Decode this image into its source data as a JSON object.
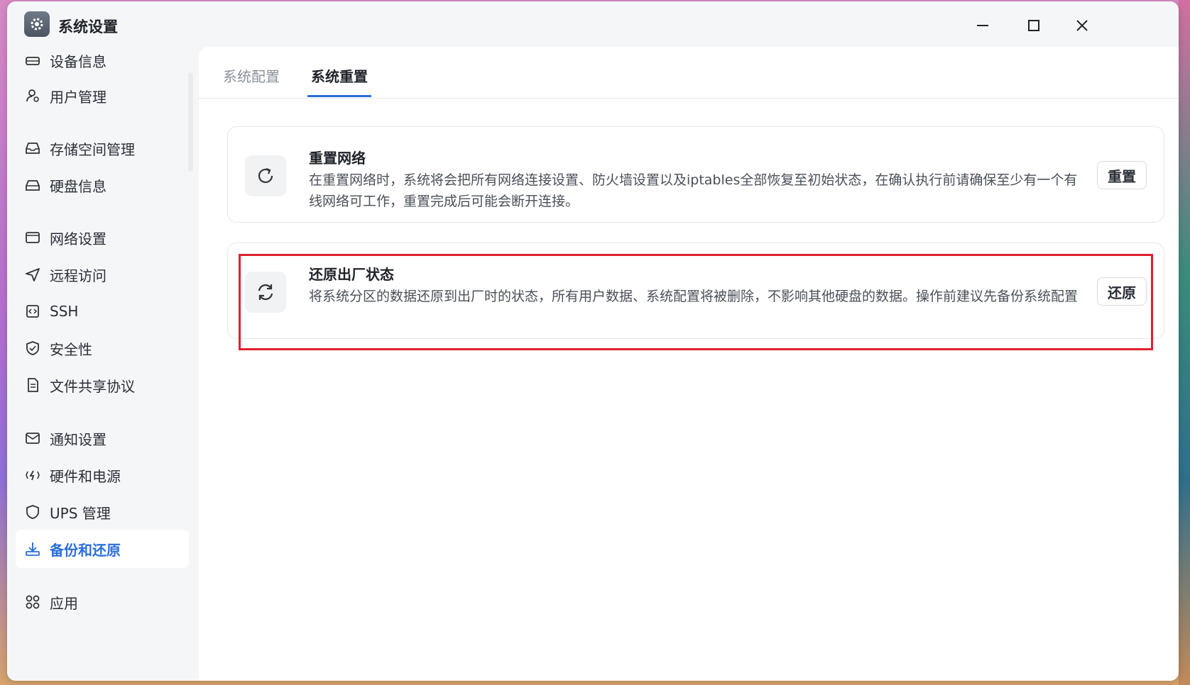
{
  "window": {
    "title": "系统设置"
  },
  "sidebar": {
    "items": [
      {
        "label": "设备信息",
        "icon": "device-icon"
      },
      {
        "label": "用户管理",
        "icon": "user-gear-icon"
      },
      {
        "label": "存储空间管理",
        "icon": "storage-icon"
      },
      {
        "label": "硬盘信息",
        "icon": "disk-icon"
      },
      {
        "label": "网络设置",
        "icon": "network-icon"
      },
      {
        "label": "远程访问",
        "icon": "send-icon"
      },
      {
        "label": "SSH",
        "icon": "ssh-icon"
      },
      {
        "label": "安全性",
        "icon": "shield-check-icon"
      },
      {
        "label": "文件共享协议",
        "icon": "document-icon"
      },
      {
        "label": "通知设置",
        "icon": "mail-icon"
      },
      {
        "label": "硬件和电源",
        "icon": "power-icon"
      },
      {
        "label": "UPS 管理",
        "icon": "shield-icon"
      },
      {
        "label": "备份和还原",
        "icon": "download-icon",
        "active": true
      },
      {
        "label": "应用",
        "icon": "apps-icon"
      }
    ]
  },
  "tabs": [
    {
      "label": "系统配置"
    },
    {
      "label": "系统重置",
      "active": true
    }
  ],
  "cards": [
    {
      "title": "重置网络",
      "description": "在重置网络时，系统将会把所有网络连接设置、防火墙设置以及iptables全部恢复至初始状态，在确认执行前请确保至少有一个有线网络可工作，重置完成后可能会断开连接。",
      "button": "重置",
      "icon": "refresh-icon"
    },
    {
      "title": "还原出厂状态",
      "description": "将系统分区的数据还原到出厂时的状态，所有用户数据、系统配置将被删除，不影响其他硬盘的数据。操作前建议先备份系统配置",
      "button": "还原",
      "icon": "sync-icon"
    }
  ],
  "colors": {
    "accent": "#2a6fdb",
    "highlight": "#e0202e"
  }
}
